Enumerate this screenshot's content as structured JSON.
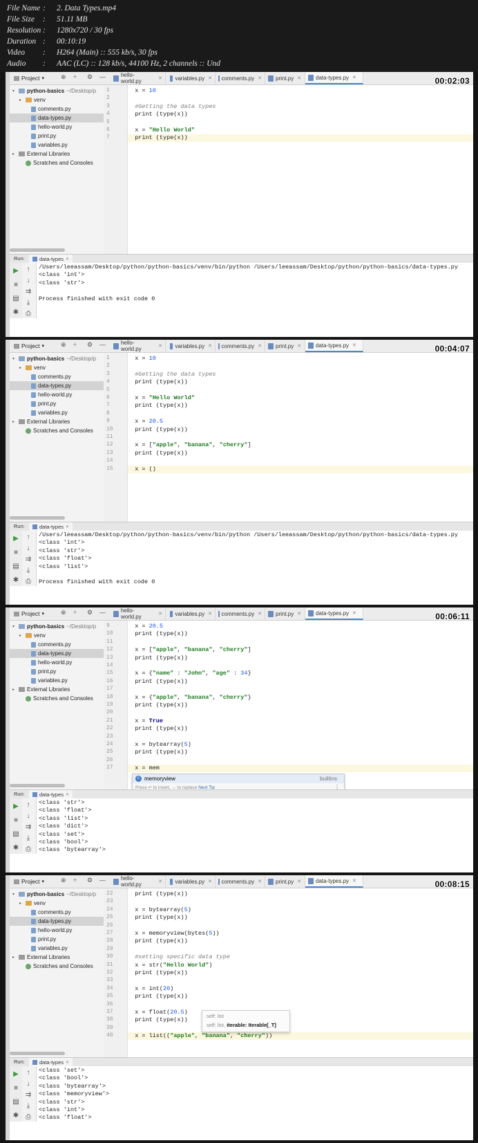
{
  "meta": [
    {
      "key": "File Name",
      "value": "2. Data Types.mp4"
    },
    {
      "key": "File Size",
      "value": "51.11 MB"
    },
    {
      "key": "Resolution",
      "value": "1280x720 / 30 fps"
    },
    {
      "key": "Duration",
      "value": "00:10:19"
    },
    {
      "key": "Video",
      "value": "H264 (Main) :: 555 kb/s, 30 fps"
    },
    {
      "key": "Audio",
      "value": "AAC (LC) :: 128 kb/s, 44100 Hz, 2 channels :: Und"
    }
  ],
  "ide": {
    "project_label": "Project",
    "project_root": "python-basics",
    "project_path": "~/Desktop/p",
    "tree": [
      "venv",
      "comments.py",
      "data-types.py",
      "hello-world.py",
      "print.py",
      "variables.py"
    ],
    "external_libraries": "External Libraries",
    "scratches": "Scratches and Consoles",
    "tabs": [
      "hello-world.py",
      "variables.py",
      "comments.py",
      "print.py",
      "data-types.py"
    ],
    "active_tab": "data-types.py",
    "run_label": "Run:",
    "run_config": "data-types"
  },
  "frames": [
    {
      "timestamp": "00:02:03",
      "first_line": 1,
      "code": [
        "x = 10",
        "",
        "#Getting the data types",
        "print (type(x))",
        "",
        "x = \"Hello World\"",
        "print (type(x))"
      ],
      "current_line": 7,
      "output": [
        "/Users/leeassam/Desktop/python/python-basics/venv/bin/python /Users/leeassam/Desktop/python/python-basics/data-types.py",
        "<class 'int'>",
        "<class 'str'>",
        "",
        "Process finished with exit code 0"
      ]
    },
    {
      "timestamp": "00:04:07",
      "first_line": 1,
      "code": [
        "x = 10",
        "",
        "#Getting the data types",
        "print (type(x))",
        "",
        "x = \"Hello World\"",
        "print (type(x))",
        "",
        "x = 20.5",
        "print (type(x))",
        "",
        "x = [\"apple\", \"banana\", \"cherry\"]",
        "print (type(x))",
        "",
        "x = ()"
      ],
      "current_line": 15,
      "output": [
        "/Users/leeassam/Desktop/python/python-basics/venv/bin/python /Users/leeassam/Desktop/python/python-basics/data-types.py",
        "<class 'int'>",
        "<class 'str'>",
        "<class 'float'>",
        "<class 'list'>",
        "",
        "Process finished with exit code 0"
      ]
    },
    {
      "timestamp": "00:06:11",
      "first_line": 9,
      "code": [
        "x = 20.5",
        "print (type(x))",
        "",
        "x = [\"apple\", \"banana\", \"cherry\"]",
        "print (type(x))",
        "",
        "x = {\"name\" : \"John\", \"age\" : 34}",
        "print (type(x))",
        "",
        "x = {\"apple\", \"banana\", \"cherry\"}",
        "print (type(x))",
        "",
        "x = True",
        "print (type(x))",
        "",
        "x = bytearray(5)",
        "print (type(x))",
        "",
        "x = mem"
      ],
      "current_line": 27,
      "autocomplete": {
        "item": "memoryview",
        "source": "builtins",
        "hint_pre": "Press",
        "hint_mid": "to insert,",
        "hint_post": "to replace",
        "next_tip": "Next Tip"
      },
      "output": [
        "<class 'str'>",
        "<class 'float'>",
        "<class 'list'>",
        "<class 'dict'>",
        "<class 'set'>",
        "<class 'bool'>",
        "<class 'bytearray'>"
      ]
    },
    {
      "timestamp": "00:08:15",
      "first_line": 22,
      "code": [
        "print (type(x))",
        "",
        "x = bytearray(5)",
        "print (type(x))",
        "",
        "x = memoryview(bytes(5))",
        "print (type(x))",
        "",
        "#setting specific data type",
        "x = str(\"Hello World\")",
        "print (type(x))",
        "",
        "x = int(20)",
        "print (type(x))",
        "",
        "x = float(20.5)",
        "print (type(x))",
        "",
        "x = list((\"apple\", \"banana\", \"cherry\"))"
      ],
      "current_line": 40,
      "param_info": {
        "line1": "self: list",
        "line2_pre": "self: list,",
        "line2_bold": "iterable: Iterable[_T]"
      },
      "output": [
        "<class 'set'>",
        "<class 'bool'>",
        "<class 'bytearray'>",
        "<class 'memoryview'>",
        "<class 'str'>",
        "<class 'int'>",
        "<class 'float'>"
      ]
    }
  ],
  "colors": {
    "string": "#1f7a22",
    "comment": "#7d7d7d",
    "number": "#1750eb",
    "keyword": "#000080",
    "active_tab_underline": "#4a88c7"
  }
}
